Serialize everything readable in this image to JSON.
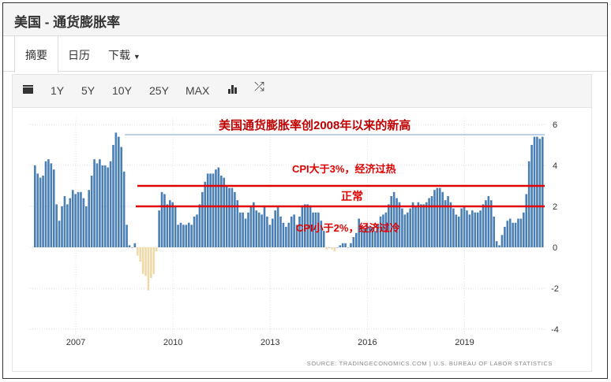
{
  "header": {
    "title": "美国 - 通货膨胀率"
  },
  "tabs": [
    {
      "label": "摘要"
    },
    {
      "label": "日历"
    },
    {
      "label": "下载"
    }
  ],
  "toolbar": {
    "ranges": [
      "1Y",
      "5Y",
      "10Y",
      "25Y",
      "MAX"
    ],
    "icons": [
      "calendar-icon",
      "bar-chart-icon",
      "shuffle-icon"
    ]
  },
  "colors": {
    "positive": "#4a7fb5",
    "negative": "#f0d9a8",
    "annotation": "#e00000"
  },
  "chart_data": {
    "type": "bar",
    "title": "美国通货膨胀率创2008年以来的新高",
    "start": "2006-01",
    "frequency": "monthly",
    "values": [
      4.0,
      3.6,
      3.4,
      3.5,
      4.2,
      4.3,
      4.1,
      3.8,
      2.1,
      1.3,
      2.0,
      2.5,
      2.1,
      2.4,
      2.8,
      2.6,
      2.7,
      2.7,
      2.4,
      2.0,
      2.8,
      3.5,
      4.3,
      4.1,
      4.3,
      4.0,
      4.0,
      3.9,
      4.2,
      5.0,
      5.6,
      5.4,
      4.9,
      3.7,
      1.1,
      0.1,
      0.0,
      0.2,
      -0.4,
      -0.7,
      -1.3,
      -1.4,
      -2.1,
      -1.5,
      -1.3,
      -0.2,
      1.8,
      2.7,
      2.6,
      2.1,
      2.3,
      2.2,
      2.0,
      1.1,
      1.2,
      1.1,
      1.1,
      1.2,
      1.1,
      1.5,
      1.6,
      2.1,
      2.7,
      3.2,
      3.6,
      3.6,
      3.6,
      3.8,
      3.9,
      3.5,
      3.4,
      3.0,
      2.9,
      2.9,
      2.7,
      2.3,
      1.7,
      1.7,
      1.4,
      1.7,
      2.0,
      2.2,
      1.8,
      1.7,
      1.6,
      2.0,
      1.5,
      1.1,
      1.4,
      1.8,
      2.0,
      1.5,
      1.2,
      1.0,
      1.2,
      1.5,
      1.6,
      1.1,
      1.5,
      2.0,
      2.1,
      2.1,
      2.0,
      1.7,
      1.7,
      1.7,
      1.3,
      0.8,
      -0.1,
      0.0,
      -0.1,
      -0.2,
      0.0,
      0.1,
      0.2,
      0.2,
      0.0,
      0.2,
      0.5,
      0.7,
      1.4,
      1.0,
      0.9,
      1.1,
      1.0,
      1.0,
      0.8,
      1.1,
      1.5,
      1.6,
      1.7,
      2.1,
      2.5,
      2.7,
      2.4,
      2.2,
      1.9,
      1.6,
      1.7,
      1.9,
      2.2,
      2.0,
      2.2,
      2.1,
      2.1,
      2.2,
      2.4,
      2.5,
      2.8,
      2.9,
      2.9,
      2.7,
      2.3,
      2.5,
      2.2,
      1.9,
      1.6,
      1.5,
      1.9,
      2.0,
      1.8,
      1.6,
      1.8,
      1.7,
      1.7,
      1.8,
      2.1,
      2.3,
      2.5,
      2.3,
      1.5,
      0.3,
      0.1,
      0.6,
      1.0,
      1.3,
      1.4,
      1.2,
      1.2,
      1.4,
      1.4,
      1.7,
      2.6,
      4.2,
      5.0,
      5.4,
      5.4,
      5.3,
      5.4
    ],
    "x_ticks": [
      {
        "label": "2007",
        "index": 12
      },
      {
        "label": "2010",
        "index": 48
      },
      {
        "label": "2013",
        "index": 84
      },
      {
        "label": "2016",
        "index": 120
      },
      {
        "label": "2019",
        "index": 156
      }
    ],
    "y_ticks": [
      "6",
      "4",
      "2",
      "0",
      "-2",
      "-4"
    ],
    "ylim": [
      -4,
      6
    ],
    "reference_lines": [
      {
        "value": 3,
        "label": "CPI大于3%，经济过热"
      },
      {
        "value": 2,
        "label": "CPI小于2%，经济过冷"
      }
    ],
    "band_label": "正常",
    "peak_line": 5.5,
    "source": "SOURCE: TRADINGECONOMICS.COM  |  U.S. BUREAU OF LABOR STATISTICS"
  }
}
